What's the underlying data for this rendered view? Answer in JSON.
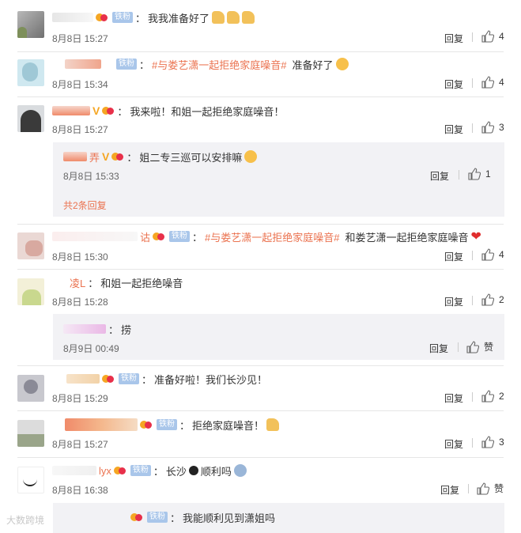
{
  "comments": [
    {
      "text": "我我准备好了",
      "badge": "铁粉",
      "time": "8月8日 15:27",
      "reply": "回复",
      "likes": "4"
    },
    {
      "topic": "#与娄艺潇一起拒绝家庭噪音#",
      "text": "准备好了",
      "badge": "铁粉",
      "time": "8月8日 15:34",
      "reply": "回复",
      "likes": "4"
    },
    {
      "text": "我来啦！和姐一起拒绝家庭噪音！",
      "time": "8月8日 15:27",
      "reply": "回复",
      "likes": "3",
      "sub": {
        "name_suffix": "弄",
        "text": "姐二专三巡可以安排嘛",
        "time": "8月8日 15:33",
        "reply": "回复",
        "likes": "1",
        "more": "共2条回复"
      }
    },
    {
      "name_suffix": "诂",
      "badge": "铁粉",
      "topic": "#与娄艺潇一起拒绝家庭噪音#",
      "text": "和娄艺潇一起拒绝家庭噪音",
      "time": "8月8日 15:30",
      "reply": "回复",
      "likes": "4"
    },
    {
      "name": "凌L",
      "text": "和姐一起拒绝噪音",
      "time": "8月8日 15:28",
      "reply": "回复",
      "likes": "2",
      "sub": {
        "text": "捞",
        "time": "8月9日 00:49",
        "reply": "回复",
        "likes": "赞"
      }
    },
    {
      "badge": "铁粉",
      "text": "准备好啦！我们长沙见！",
      "time": "8月8日 15:29",
      "reply": "回复",
      "likes": "2"
    },
    {
      "badge": "铁粉",
      "text": "拒绝家庭噪音！",
      "time": "8月8日 15:27",
      "reply": "回复",
      "likes": "3"
    },
    {
      "name": "lyx",
      "badge": "铁粉",
      "text_a": "长沙",
      "text_b": "顺利吗",
      "time": "8月8日 16:38",
      "reply": "回复",
      "likes": "赞"
    },
    {
      "badge": "铁粉",
      "text": "我能顺利见到潇姐吗"
    }
  ],
  "watermark": "大数跨境",
  "colors": {
    "accent": "#eb7350",
    "badge": "#a9c6ea",
    "sub_bg": "#f2f2f5"
  }
}
